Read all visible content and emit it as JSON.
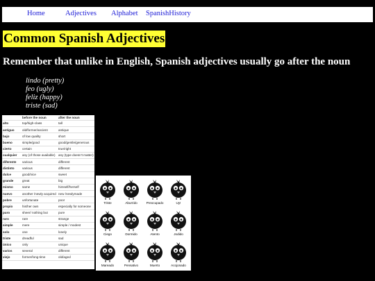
{
  "nav": {
    "items": [
      "Home",
      "Adjectives",
      "Alphabet",
      "SpanishHistory"
    ]
  },
  "page": {
    "title": "Common Spanish Adjectives",
    "subtitle": "Remember that unlike in English, Spanish adjectives usually go after the noun",
    "examples": [
      "lindo (pretty)",
      "feo (ugly)",
      "feliz (happy)",
      "triste (sad)"
    ]
  },
  "adjective_table": {
    "headers": [
      "",
      "before the noun",
      "after the noun"
    ],
    "rows": [
      [
        "alto",
        "top/high-class",
        "tall"
      ],
      [
        "antiguo",
        "old/former/ancient",
        "antique"
      ],
      [
        "bajo",
        "of low quality",
        "short"
      ],
      [
        "bueno",
        "simple/good",
        "good/gentle/generous"
      ],
      [
        "cierto",
        "certain",
        "true/right"
      ],
      [
        "cualquier",
        "any (of those available)",
        "any (type doesn't matter)"
      ],
      [
        "diferente",
        "various",
        "different"
      ],
      [
        "distinto",
        "various",
        "different"
      ],
      [
        "dulce",
        "good/nice",
        "sweet"
      ],
      [
        "grande",
        "great",
        "big"
      ],
      [
        "mismo",
        "same",
        "himself/herself"
      ],
      [
        "nuevo",
        "another /newly acquired",
        "new /newlymade"
      ],
      [
        "pobre",
        "unfortunate",
        "poor"
      ],
      [
        "propio",
        "his/her own",
        "especially for someone"
      ],
      [
        "puro",
        "sheer/ nothing but",
        "pure"
      ],
      [
        "raro",
        "rare",
        "strange"
      ],
      [
        "simple",
        "mere",
        "simple / modest"
      ],
      [
        "solo",
        "one",
        "lonely"
      ],
      [
        "triste",
        "dreadful",
        "sad"
      ],
      [
        "único",
        "only",
        "unique"
      ],
      [
        "varios",
        "several",
        "different"
      ],
      [
        "viejo",
        "former/long-time",
        "old/aged"
      ]
    ]
  },
  "emotion_birds": {
    "labels": [
      "Triste",
      "Aburrido",
      "Preocupado",
      "Uy!",
      "Ciego",
      "Dormido",
      "Atento",
      "Jodido",
      "Mareado",
      "Pensativo",
      "Muerto",
      "Acojonado"
    ]
  },
  "colors": {
    "background": "#000000",
    "nav_background": "#ffffff",
    "nav_link": "#1a1ad6",
    "title_highlight": "#ffff33",
    "text": "#ffffff"
  }
}
